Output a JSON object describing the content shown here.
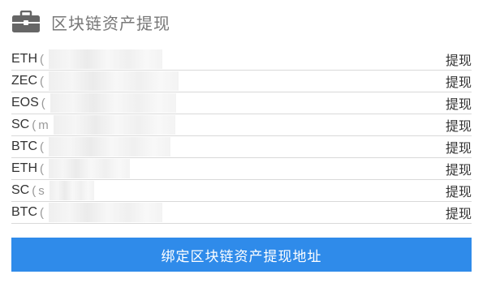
{
  "header": {
    "icon": "briefcase-icon",
    "title": "区块链资产提现"
  },
  "withdraw_list": [
    {
      "coin": "ETH",
      "address_prefix": "",
      "action": "提现"
    },
    {
      "coin": "ZEC",
      "address_prefix": "",
      "action": "提现"
    },
    {
      "coin": "EOS",
      "address_prefix": "",
      "action": "提现"
    },
    {
      "coin": "SC",
      "address_prefix": "m",
      "action": "提现"
    },
    {
      "coin": "BTC",
      "address_prefix": "",
      "action": "提现"
    },
    {
      "coin": "ETH",
      "address_prefix": "",
      "action": "提现"
    },
    {
      "coin": "SC",
      "address_prefix": "s",
      "action": "提现"
    },
    {
      "coin": "BTC",
      "address_prefix": "",
      "action": "提现"
    }
  ],
  "bind_button": {
    "label": "绑定区块链资产提现地址"
  },
  "colors": {
    "primary_button": "#2f8bea",
    "divider": "#d9d9d9",
    "icon": "#666666"
  }
}
